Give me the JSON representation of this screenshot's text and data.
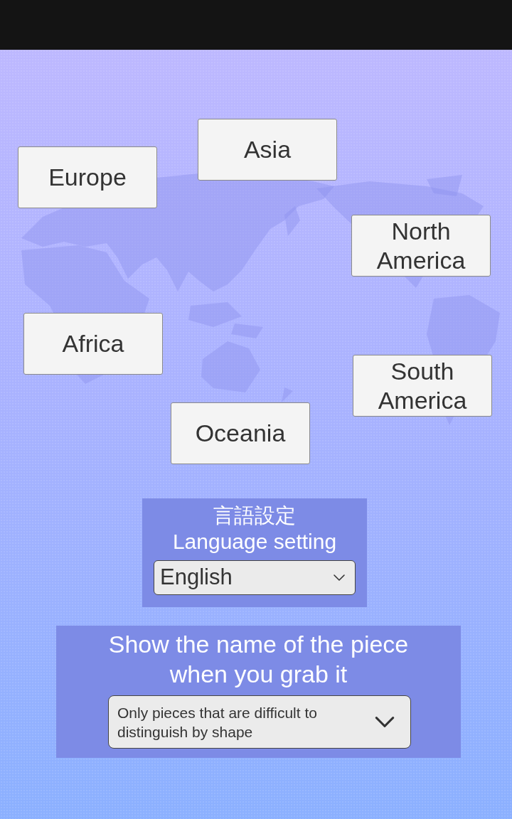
{
  "map": {
    "pieces": [
      {
        "label": "Asia"
      },
      {
        "label": "Europe"
      },
      {
        "label": "North America"
      },
      {
        "label": "Africa"
      },
      {
        "label": "South America"
      },
      {
        "label": "Oceania"
      }
    ]
  },
  "language_setting": {
    "title_ja": "言語設定",
    "title": "Language setting",
    "dropdown": {
      "value": "English"
    }
  },
  "name_display_setting": {
    "title": "Show the name of the piece when you grab it",
    "dropdown": {
      "value": "Only pieces that are difficult to distinguish by shape"
    }
  }
}
